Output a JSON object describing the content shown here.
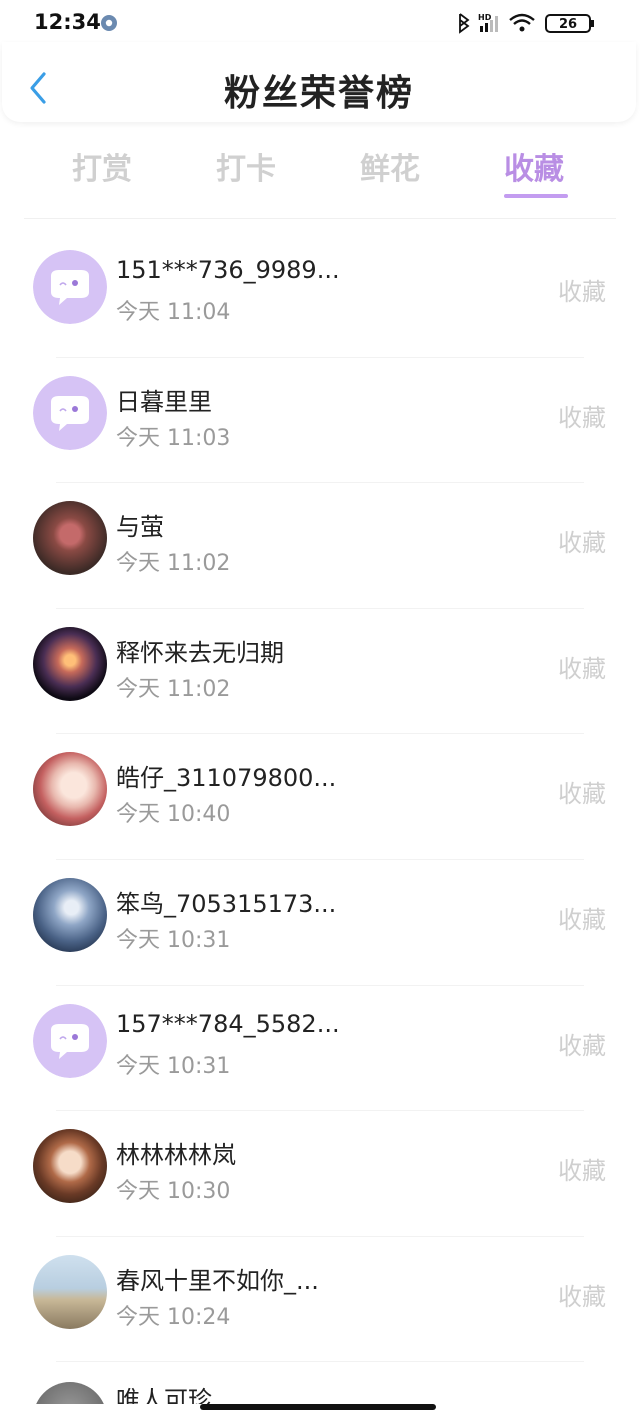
{
  "status_bar": {
    "time": "12:34",
    "hd_label": "HD",
    "battery": "26"
  },
  "header": {
    "title": "粉丝荣誉榜"
  },
  "tabs": [
    {
      "label": "打赏",
      "active": false
    },
    {
      "label": "打卡",
      "active": false
    },
    {
      "label": "鲜花",
      "active": false
    },
    {
      "label": "收藏",
      "active": true
    }
  ],
  "colors": {
    "accent": "#b98ee4",
    "inactive_tab": "#d0d0d0",
    "muted_text": "#9a9a9a"
  },
  "list": {
    "items": [
      {
        "name": "151***736_9989...",
        "time": "今天 11:04",
        "action": "收藏",
        "avatar": "default-chat-avatar"
      },
      {
        "name": "日暮里里",
        "time": "今天 11:03",
        "action": "收藏",
        "avatar": "default-chat-avatar"
      },
      {
        "name": "与萤",
        "time": "今天 11:02",
        "action": "收藏",
        "avatar": "photo-avatar"
      },
      {
        "name": "释怀来去无归期",
        "time": "今天 11:02",
        "action": "收藏",
        "avatar": "photo-avatar"
      },
      {
        "name": "皓仔_311079800...",
        "time": "今天 10:40",
        "action": "收藏",
        "avatar": "photo-avatar"
      },
      {
        "name": "笨鸟_705315173...",
        "time": "今天 10:31",
        "action": "收藏",
        "avatar": "photo-avatar"
      },
      {
        "name": "157***784_5582...",
        "time": "今天 10:31",
        "action": "收藏",
        "avatar": "default-chat-avatar"
      },
      {
        "name": "林林林林岚",
        "time": "今天 10:30",
        "action": "收藏",
        "avatar": "photo-avatar"
      },
      {
        "name": "春风十里不如你_...",
        "time": "今天 10:24",
        "action": "收藏",
        "avatar": "photo-avatar"
      }
    ],
    "partial_item": {
      "name": "唯人可珍"
    }
  }
}
